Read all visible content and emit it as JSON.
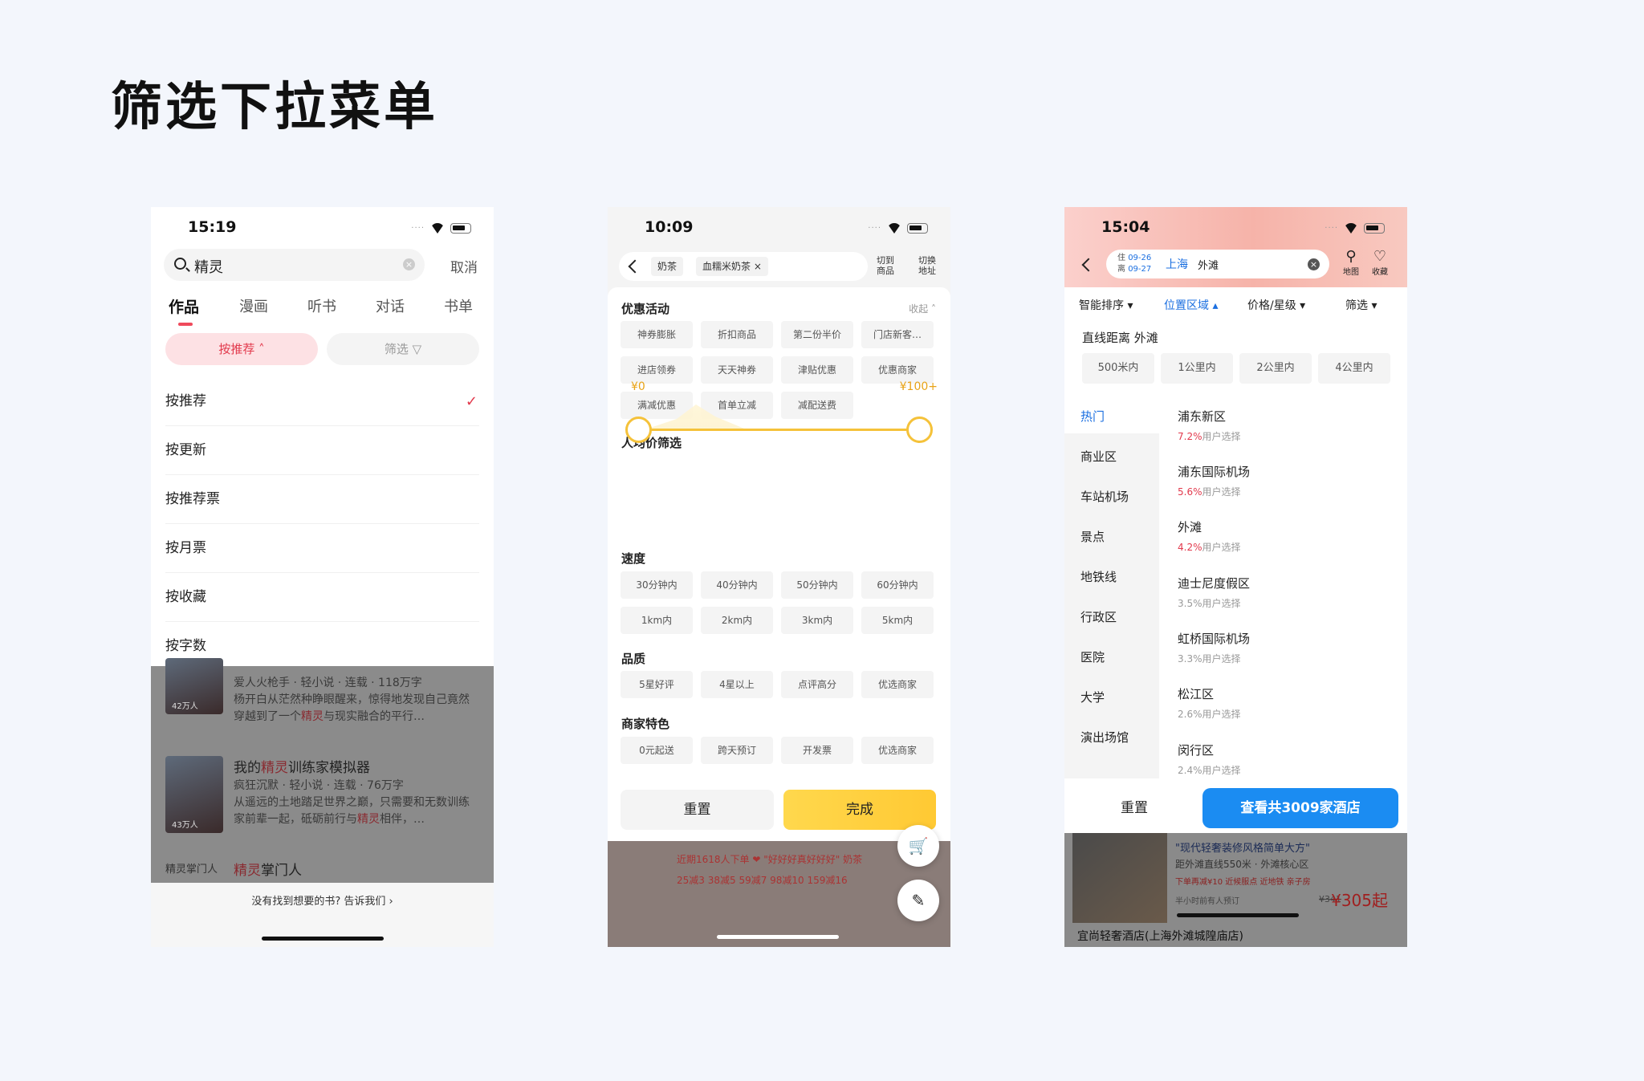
{
  "page": {
    "title": "筛选下拉菜单"
  },
  "phone1": {
    "time": "15:19",
    "search": {
      "query": "精灵",
      "cancel": "取消"
    },
    "tabs": [
      "作品",
      "漫画",
      "听书",
      "对话",
      "书单"
    ],
    "chip_sort": "按推荐 ˄",
    "chip_filter": "筛选 ▽",
    "sort_options": [
      "按推荐",
      "按更新",
      "按推荐票",
      "按月票",
      "按收藏",
      "按字数"
    ],
    "selected_check": "✓",
    "books": [
      {
        "title": "",
        "meta": "爱人火枪手 · 轻小说 · 连载 · 118万字",
        "desc_a": "杨开白从茫然种睁眼醒来，惊得地发现自己竟然穿越到了一个",
        "desc_hl": "精灵",
        "desc_b": "与现实融合的平行…",
        "cover": "42万人"
      },
      {
        "title_a": "我的",
        "title_hl": "精灵",
        "title_b": "训练家模拟器",
        "meta": "疯狂沉默 · 轻小说 · 连载 · 76万字",
        "desc_a": "从遥远的土地踏足世界之巅，只需要和无数训练家前辈一起，砥砺前行与",
        "desc_hl": "精灵",
        "desc_b": "相伴，…",
        "cover": "43万人"
      },
      {
        "title_hl": "精灵",
        "title_b": "掌门人",
        "cover_text": "精灵掌门人"
      }
    ],
    "bottom_hint": "没有找到想要的书? 告诉我们 ›"
  },
  "phone2": {
    "time": "10:09",
    "tags": [
      "奶茶",
      "血糯米奶茶 ×"
    ],
    "side_buttons": [
      "切到商品",
      "切换地址"
    ],
    "sections": {
      "promo": {
        "title": "优惠活动",
        "collapse": "收起 ˄",
        "options": [
          "神券膨胀",
          "折扣商品",
          "第二份半价",
          "门店新客…",
          "进店领券",
          "天天神券",
          "津贴优惠",
          "优惠商家",
          "满减优惠",
          "首单立减",
          "减配送费"
        ]
      },
      "price": {
        "title": "人均价筛选",
        "min": "¥0",
        "max": "¥100+",
        "range_selected": [
          0,
          1
        ]
      },
      "speed": {
        "title": "速度",
        "options": [
          "30分钟内",
          "40分钟内",
          "50分钟内",
          "60分钟内",
          "1km内",
          "2km内",
          "3km内",
          "5km内"
        ]
      },
      "quality": {
        "title": "品质",
        "options": [
          "5星好评",
          "4星以上",
          "点评高分",
          "优选商家"
        ]
      },
      "feature": {
        "title": "商家特色",
        "options": [
          "0元起送",
          "跨天预订",
          "开发票",
          "优选商家"
        ]
      }
    },
    "reset": "重置",
    "done": "完成",
    "behind_promo": "近期1618人下单  ❤ \"好好好真好好好\"  奶茶",
    "behind_promo2": "25减3  38减5  59减7  98减10  159减16"
  },
  "phone3": {
    "time": "15:04",
    "dates": {
      "checkin_label": "住",
      "checkin": "09-26",
      "checkout_label": "离",
      "checkout": "09-27"
    },
    "city": "上海",
    "area": "外滩",
    "map": "地图",
    "fav": "收藏",
    "filters": [
      "智能排序 ▾",
      "位置区域 ▴",
      "价格/星级 ▾",
      "筛选 ▾"
    ],
    "distance_label": "直线距离  外滩",
    "distance_options": [
      "500米内",
      "1公里内",
      "2公里内",
      "4公里内"
    ],
    "categories": [
      "热门",
      "商业区",
      "车站机场",
      "景点",
      "地铁线",
      "行政区",
      "医院",
      "大学",
      "演出场馆"
    ],
    "locations": [
      {
        "name": "浦东新区",
        "pct": "7.2%",
        "suffix": "用户选择"
      },
      {
        "name": "浦东国际机场",
        "pct": "5.6%",
        "suffix": "用户选择"
      },
      {
        "name": "外滩",
        "pct": "4.2%",
        "suffix": "用户选择"
      },
      {
        "name": "迪士尼度假区",
        "pct": "3.5%",
        "suffix": "用户选择"
      },
      {
        "name": "虹桥国际机场",
        "pct": "3.3%",
        "suffix": "用户选择"
      },
      {
        "name": "松江区",
        "pct": "2.6%",
        "suffix": "用户选择"
      },
      {
        "name": "闵行区",
        "pct": "2.4%",
        "suffix": "用户选择"
      }
    ],
    "reset": "重置",
    "view": "查看共3009家酒店",
    "behind": {
      "t1": "\"现代轻奢装修风格简单大方\"",
      "t2": "距外滩直线550米 · 外滩核心区",
      "t3": "下单再减¥10  近候服点  近地铁  亲子房",
      "t4": "半小时前有人预订",
      "old": "¥341",
      "price": "¥305起",
      "t5": "宜尚轻奢酒店(上海外滩城隍庙店)"
    }
  },
  "colors": {
    "red_accent": "#e2394c",
    "yellow_accent": "#f5c23a",
    "blue_accent": "#1b8cf2"
  }
}
